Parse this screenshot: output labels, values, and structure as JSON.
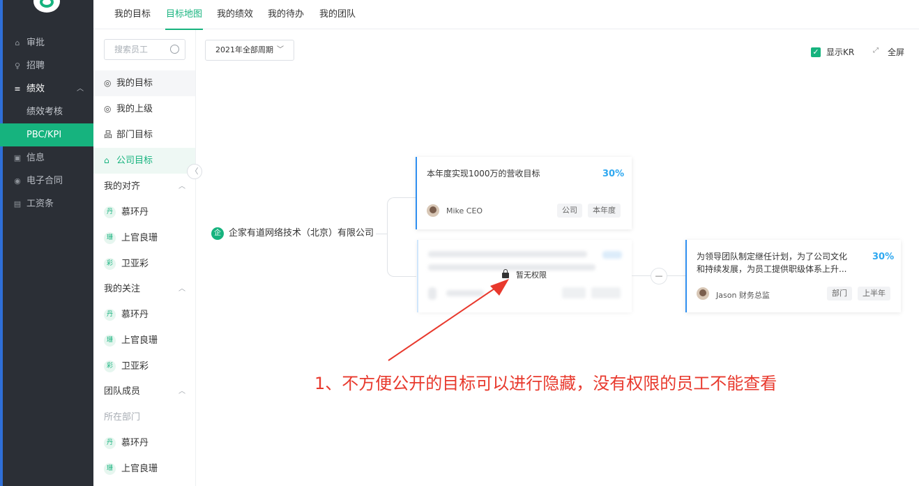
{
  "sidebar": {
    "items": [
      {
        "icon": "⌂",
        "icon_name": "approval-icon",
        "label": "审批"
      },
      {
        "icon": "♀",
        "icon_name": "recruit-icon",
        "label": "招聘"
      },
      {
        "icon": "≡",
        "icon_name": "performance-icon",
        "label": "绩效",
        "expanded": true
      },
      {
        "label": "绩效考核"
      },
      {
        "label": "PBC/KPI",
        "active": true
      },
      {
        "icon": "▣",
        "icon_name": "info-icon",
        "label": "信息"
      },
      {
        "icon": "◉",
        "icon_name": "contract-icon",
        "label": "电子合同"
      },
      {
        "icon": "▤",
        "icon_name": "payslip-icon",
        "label": "工资条"
      }
    ]
  },
  "tabs": [
    "我的目标",
    "目标地图",
    "我的绩效",
    "我的待办",
    "我的团队"
  ],
  "active_tab": "目标地图",
  "panel": {
    "search_placeholder": "搜索员工",
    "menu": [
      {
        "icon": "◎",
        "icon_name": "target-icon",
        "label": "我的目标"
      },
      {
        "icon": "◎",
        "icon_name": "superior-target-icon",
        "label": "我的上级"
      },
      {
        "icon": "品",
        "icon_name": "department-icon",
        "label": "部门目标"
      },
      {
        "icon": "⌂",
        "icon_name": "company-icon",
        "label": "公司目标"
      }
    ],
    "align_title": "我的对齐",
    "align": [
      {
        "avatar": "丹",
        "name": "慕环丹"
      },
      {
        "avatar": "珊",
        "name": "上官良珊"
      },
      {
        "avatar": "彩",
        "name": "卫亚彩"
      }
    ],
    "follow_title": "我的关注",
    "follow": [
      {
        "avatar": "丹",
        "name": "慕环丹"
      },
      {
        "avatar": "珊",
        "name": "上官良珊"
      },
      {
        "avatar": "彩",
        "name": "卫亚彩"
      }
    ],
    "team_title": "团队成员",
    "dept_title": "所在部门",
    "team": [
      {
        "avatar": "丹",
        "name": "慕环丹"
      },
      {
        "avatar": "珊",
        "name": "上官良珊"
      }
    ]
  },
  "toolbar": {
    "period": "2021年全部周期",
    "show_kr": "显示KR",
    "fullscreen": "全屏"
  },
  "map": {
    "org": "企家有道网络技术（北京）有限公司",
    "card1": {
      "title": "本年度实现1000万的营收目标",
      "percent": "30%",
      "owner": "Mike  CEO",
      "tags": [
        "公司",
        "本年度"
      ]
    },
    "locked": "暂无权限",
    "card3": {
      "title_line1": "为领导团队制定继任计划，为了公司文化",
      "title_line2": "和持续发展，为员工提供职级体系上升...",
      "percent": "30%",
      "owner": "Jason 财务总监",
      "tags": [
        "部门",
        "上半年"
      ]
    },
    "connector": "—"
  },
  "annotation": "1、不方便公开的目标可以进行隐藏，没有权限的员工不能查看",
  "colors": {
    "accent": "#16b37e",
    "sidebar": "#2b2f36",
    "annotation": "#e8392d",
    "percent": "#2fa8f0"
  }
}
